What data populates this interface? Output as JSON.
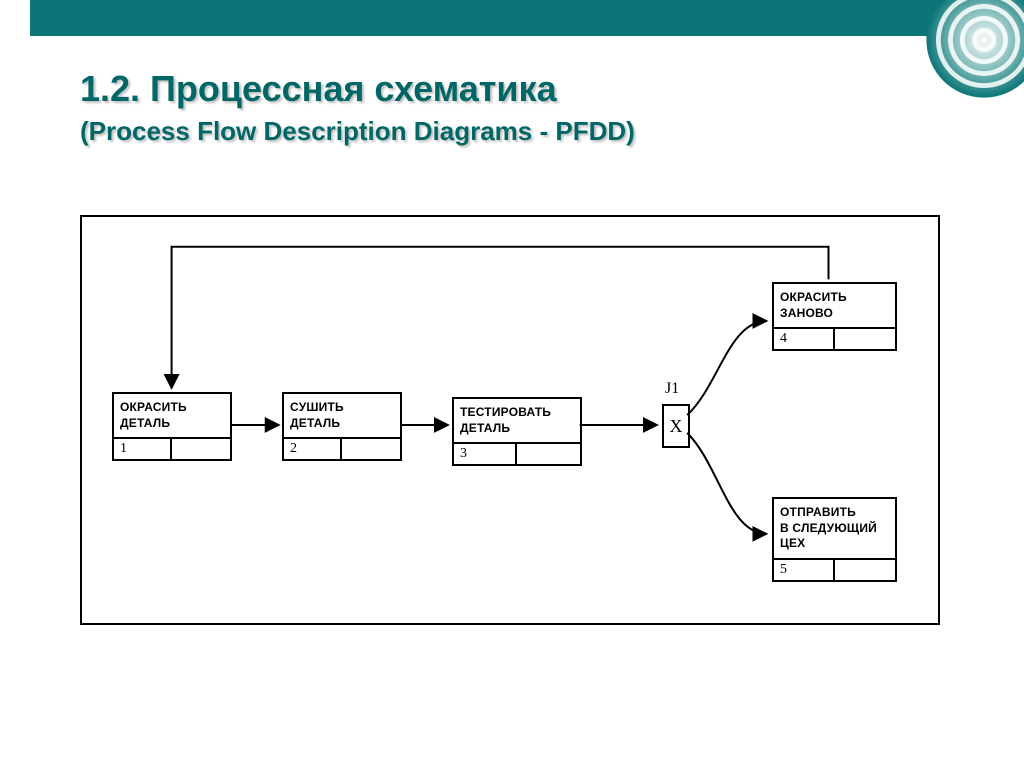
{
  "header": {
    "title": "1.2. Процессная схематика",
    "subtitle": "(Process Flow Description Diagrams - PFDD)"
  },
  "diagram": {
    "junction": {
      "id": "J1",
      "type": "X"
    },
    "boxes": {
      "b1": {
        "label": "ОКРАСИТЬ\nДЕТАЛЬ",
        "num": "1"
      },
      "b2": {
        "label": "СУШИТЬ\nДЕТАЛЬ",
        "num": "2"
      },
      "b3": {
        "label": "ТЕСТИРОВАТЬ\nДЕТАЛЬ",
        "num": "3"
      },
      "b4": {
        "label": "ОКРАСИТЬ\nЗАНОВО",
        "num": "4"
      },
      "b5": {
        "label": "ОТПРАВИТЬ\nВ СЛЕДУЮЩИЙ\nЦЕХ",
        "num": "5"
      }
    }
  }
}
